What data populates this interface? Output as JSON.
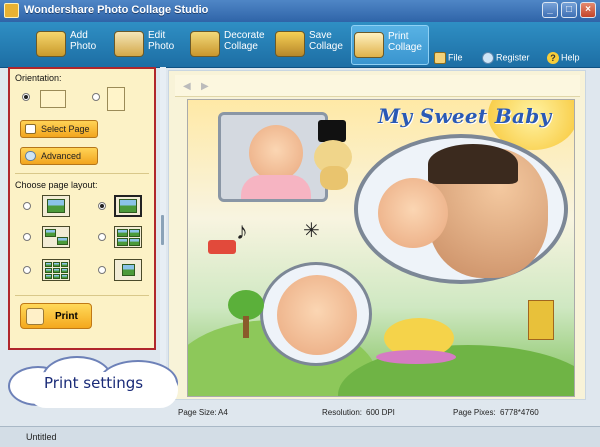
{
  "window": {
    "title": "Wondershare Photo Collage Studio"
  },
  "toolbar": {
    "buttons": [
      {
        "label": "Add\nPhoto",
        "icon": "add-photo-icon"
      },
      {
        "label": "Edit\nPhoto",
        "icon": "edit-photo-icon"
      },
      {
        "label": "Decorate\nCollage",
        "icon": "decorate-icon"
      },
      {
        "label": "Save\nCollage",
        "icon": "save-icon"
      },
      {
        "label": "Print\nCollage",
        "icon": "print-icon",
        "active": true
      }
    ],
    "links": {
      "file": "File",
      "register": "Register",
      "help": "Help"
    }
  },
  "panel": {
    "orientation_label": "Orientation:",
    "orientation_selected": "portrait",
    "select_page": "Select Page",
    "advanced": "Advanced",
    "layout_label": "Choose page layout:",
    "layout_selected_index": 1,
    "print": "Print"
  },
  "canvas": {
    "title": "My Sweet Baby"
  },
  "callout": {
    "text": "Print settings"
  },
  "status": {
    "page_size_label": "Page Size:",
    "page_size_value": "A4",
    "resolution_label": "Resolution:",
    "resolution_value": "600 DPI",
    "page_pixes_label": "Page Pixes:",
    "page_pixes_value": "6778*4760"
  },
  "bottombar": {
    "document": "Untitled"
  },
  "colors": {
    "toolbar": "#1d6ea4",
    "panel": "#fcf2c6",
    "highlight_border": "#b0262b",
    "button": "#f4a81d"
  }
}
